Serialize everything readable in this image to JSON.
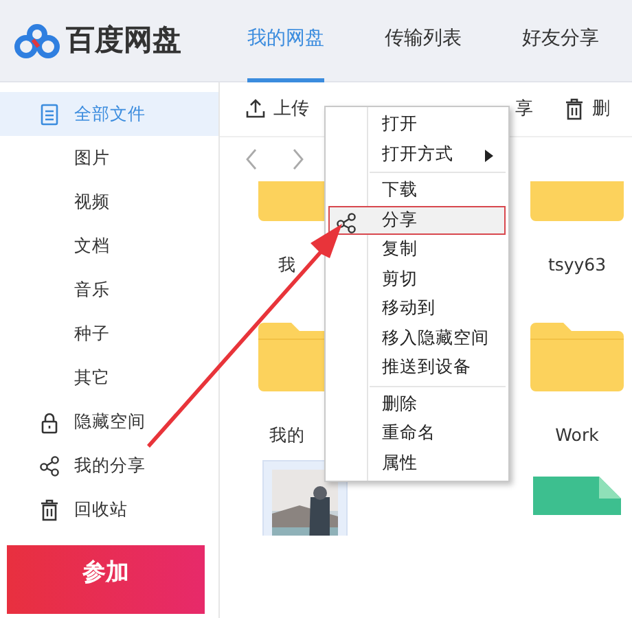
{
  "app": {
    "logo_text": "百度网盘"
  },
  "tabs": [
    {
      "label": "我的网盘",
      "selected": true
    },
    {
      "label": "传输列表",
      "selected": false
    },
    {
      "label": "好友分享",
      "selected": false
    }
  ],
  "sidebar": {
    "items": [
      {
        "label": "全部文件",
        "kind": "files",
        "selected": true,
        "children": [
          {
            "label": "图片",
            "selected": false
          },
          {
            "label": "视频",
            "selected": false
          },
          {
            "label": "文档",
            "selected": false
          },
          {
            "label": "音乐",
            "selected": false
          },
          {
            "label": "种子",
            "selected": false
          },
          {
            "label": "其它",
            "selected": false
          }
        ]
      },
      {
        "label": "隐藏空间",
        "kind": "hidden",
        "selected": false
      },
      {
        "label": "我的分享",
        "kind": "shares",
        "selected": false
      },
      {
        "label": "回收站",
        "kind": "recycle",
        "selected": false
      }
    ]
  },
  "banner": {
    "title": "参加"
  },
  "toolbar": {
    "buttons": [
      {
        "label": "上传",
        "kind": "upload"
      },
      {
        "label": "享",
        "kind": "share"
      },
      {
        "label": "删",
        "kind": "delete"
      }
    ]
  },
  "file_rows": [
    {
      "cells": [
        {
          "kind": "folder",
          "name": "我"
        },
        {
          "kind": "folder",
          "name": "tsyy63"
        }
      ]
    },
    {
      "cells": [
        {
          "kind": "folder",
          "name": "我的"
        },
        {
          "kind": "folder",
          "name": "Work"
        }
      ]
    },
    {
      "cells": [
        {
          "kind": "picture"
        },
        {
          "kind": "document"
        }
      ]
    }
  ],
  "context_menu": {
    "items": [
      {
        "kind": "item",
        "label": "打开",
        "submenu": false,
        "selected": false
      },
      {
        "kind": "item",
        "label": "打开方式",
        "submenu": true,
        "selected": false
      },
      {
        "kind": "separator"
      },
      {
        "kind": "item",
        "label": "下载",
        "submenu": false,
        "selected": false
      },
      {
        "kind": "share",
        "label": "分享",
        "submenu": false,
        "selected": true
      },
      {
        "kind": "item",
        "label": "复制",
        "submenu": false,
        "selected": false
      },
      {
        "kind": "item",
        "label": "剪切",
        "submenu": false,
        "selected": false
      },
      {
        "kind": "item",
        "label": "移动到",
        "submenu": false,
        "selected": false
      },
      {
        "kind": "item",
        "label": "移入隐藏空间",
        "submenu": false,
        "selected": false
      },
      {
        "kind": "item",
        "label": "推送到设备",
        "submenu": false,
        "selected": false
      },
      {
        "kind": "separator"
      },
      {
        "kind": "item",
        "label": "删除",
        "submenu": false,
        "selected": false
      },
      {
        "kind": "item",
        "label": "重命名",
        "submenu": false,
        "selected": false
      },
      {
        "kind": "item",
        "label": "属性",
        "submenu": false,
        "selected": false
      }
    ]
  },
  "annotation": {
    "kind": "arrow"
  }
}
